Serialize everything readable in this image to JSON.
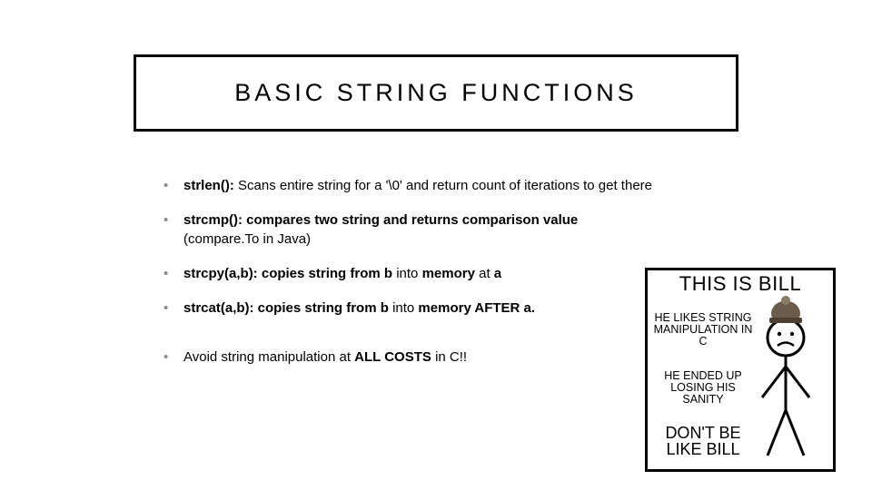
{
  "title": "BASIC STRING FUNCTIONS",
  "bullets": {
    "b0": {
      "fn": "strlen():",
      "rest": "  Scans entire string for a '\\0' and return count of iterations to get there"
    },
    "b1": {
      "fn": "strcmp(): compares two string and returns comparison value",
      "sub": "(compare.To in Java)"
    },
    "b2": {
      "fn": "strcpy(a,b): copies string from",
      "mid1": "b",
      "mid2": "into",
      "mid3": "memory",
      "tail": "at",
      "end": "a"
    },
    "b3": {
      "fn": "strcat(a,b): copies string from",
      "mid1": "b",
      "mid2": "into",
      "mid3": "memory AFTER a."
    },
    "b4": {
      "pre": "Avoid string manipulation at ",
      "strong": "ALL COSTS",
      "post": " in C!!"
    }
  },
  "meme": {
    "top": "THIS IS BILL",
    "l1": "HE LIKES STRING\nMANIPULATION IN C",
    "l2": "HE ENDED UP\nLOSING HIS SANITY",
    "dont": "DON'T BE\nLIKE BILL"
  }
}
